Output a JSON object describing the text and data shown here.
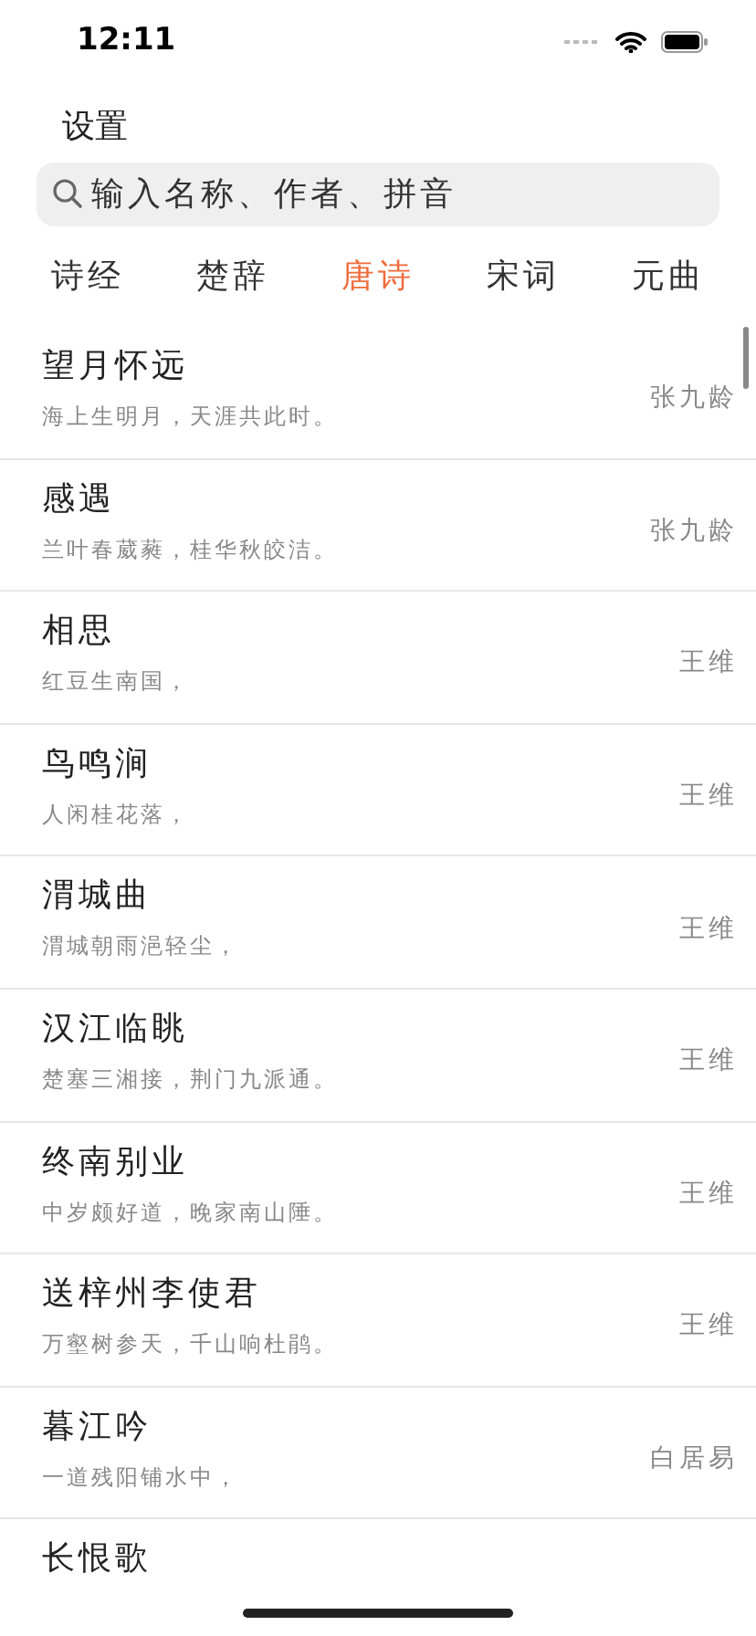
{
  "status_bar": {
    "time": "12:11"
  },
  "header": {
    "settings": "设置"
  },
  "search": {
    "placeholder": "输入名称、作者、拼音"
  },
  "tabs": [
    {
      "label": "诗经",
      "selected": false
    },
    {
      "label": "楚辞",
      "selected": false
    },
    {
      "label": "唐诗",
      "selected": true
    },
    {
      "label": "宋词",
      "selected": false
    },
    {
      "label": "元曲",
      "selected": false
    }
  ],
  "poems": [
    {
      "title": "望月怀远",
      "line": "海上生明月，天涯共此时。",
      "author": "张九龄"
    },
    {
      "title": "感遇",
      "line": "兰叶春葳蕤，桂华秋皎洁。",
      "author": "张九龄"
    },
    {
      "title": "相思",
      "line": "红豆生南国，",
      "author": "王维"
    },
    {
      "title": "鸟鸣涧",
      "line": "人闲桂花落，",
      "author": "王维"
    },
    {
      "title": "渭城曲",
      "line": "渭城朝雨浥轻尘，",
      "author": "王维"
    },
    {
      "title": "汉江临眺",
      "line": "楚塞三湘接，荆门九派通。",
      "author": "王维"
    },
    {
      "title": "终南别业",
      "line": "中岁颇好道，晚家南山陲。",
      "author": "王维"
    },
    {
      "title": "送梓州李使君",
      "line": "万壑树参天，千山响杜鹃。",
      "author": "王维"
    },
    {
      "title": "暮江吟",
      "line": "一道残阳铺水中，",
      "author": "白居易"
    },
    {
      "title": "长恨歌"
    }
  ]
}
